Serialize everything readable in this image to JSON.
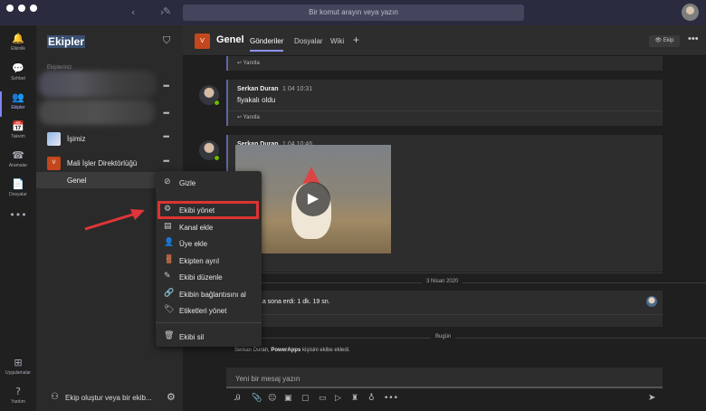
{
  "titlebar": {
    "search_placeholder": "Bir komut arayın veya yazın"
  },
  "rail": [
    {
      "name": "activity",
      "label": "Etkinlik",
      "icon": "bell-icon",
      "glyph": "🔔"
    },
    {
      "name": "chat",
      "label": "Sohbet",
      "icon": "chat-icon",
      "glyph": "💬"
    },
    {
      "name": "teams",
      "label": "Ekipler",
      "icon": "teams-icon",
      "glyph": "👥"
    },
    {
      "name": "calendar",
      "label": "Takvim",
      "icon": "calendar-icon",
      "glyph": "📅"
    },
    {
      "name": "calls",
      "label": "Aramalar",
      "icon": "phone-icon",
      "glyph": "☎"
    },
    {
      "name": "files",
      "label": "Dosyalar",
      "icon": "file-icon",
      "glyph": "📄"
    },
    {
      "name": "more",
      "label": "",
      "icon": "more-icon",
      "glyph": "•••"
    }
  ],
  "rail_bottom": [
    {
      "name": "apps",
      "label": "Uygulamalar",
      "icon": "apps-icon",
      "glyph": "⊞"
    },
    {
      "name": "help",
      "label": "Yardım",
      "icon": "help-icon",
      "glyph": "?"
    }
  ],
  "sidebar": {
    "title": "Ekipler",
    "section": "Ekipleriniz",
    "teams": [
      {
        "name": "İşimiz"
      },
      {
        "name": "Mali İşler Direktörlüğü",
        "initial": "V"
      }
    ],
    "channel": "Genel",
    "create_label": "Ekip oluştur veya bir ekib..."
  },
  "header": {
    "initial": "V",
    "title": "Genel",
    "tabs": [
      "Gönderiler",
      "Dosyalar",
      "Wiki"
    ],
    "team_button": "Ekip"
  },
  "messages": [
    {
      "author": "Serkan Duran",
      "time": "1 04 10:31",
      "text": "fiyakalı oldu"
    },
    {
      "author": "Serkan Duran",
      "time": "1 04 10:46",
      "text": ""
    }
  ],
  "reply_label": "Yanıtla",
  "call_message": "...a sona erdi: 1 dk. 19 sn.",
  "date_separators": [
    "3 Nisan 2020",
    "Bugün"
  ],
  "system_message": {
    "prefix": "Serkan Duran, ",
    "bold": "PowerApps",
    "suffix": " kişisini ekibe ekledi."
  },
  "compose_placeholder": "Yeni bir mesaj yazın",
  "context_menu": [
    {
      "label": "Gizle",
      "icon": "hide-icon",
      "glyph": "⊘"
    },
    {
      "label": "Ekibi yönet",
      "icon": "gear-icon",
      "glyph": "⚙"
    },
    {
      "label": "Kanal ekle",
      "icon": "add-channel-icon",
      "glyph": "▤"
    },
    {
      "label": "Üye ekle",
      "icon": "add-member-icon",
      "glyph": "👤"
    },
    {
      "label": "Ekipten ayrıl",
      "icon": "leave-icon",
      "glyph": "🚪"
    },
    {
      "label": "Ekibi düzenle",
      "icon": "edit-icon",
      "glyph": "✎"
    },
    {
      "label": "Ekibin bağlantısını al",
      "icon": "link-icon",
      "glyph": "🔗"
    },
    {
      "label": "Etiketleri yönet",
      "icon": "tag-icon",
      "glyph": "🏷"
    },
    {
      "label": "Ekibi sil",
      "icon": "delete-icon",
      "glyph": "🗑"
    }
  ],
  "colors": {
    "accent": "#6264a7",
    "highlight": "#dd3333",
    "team_icon": "#c3471c"
  }
}
